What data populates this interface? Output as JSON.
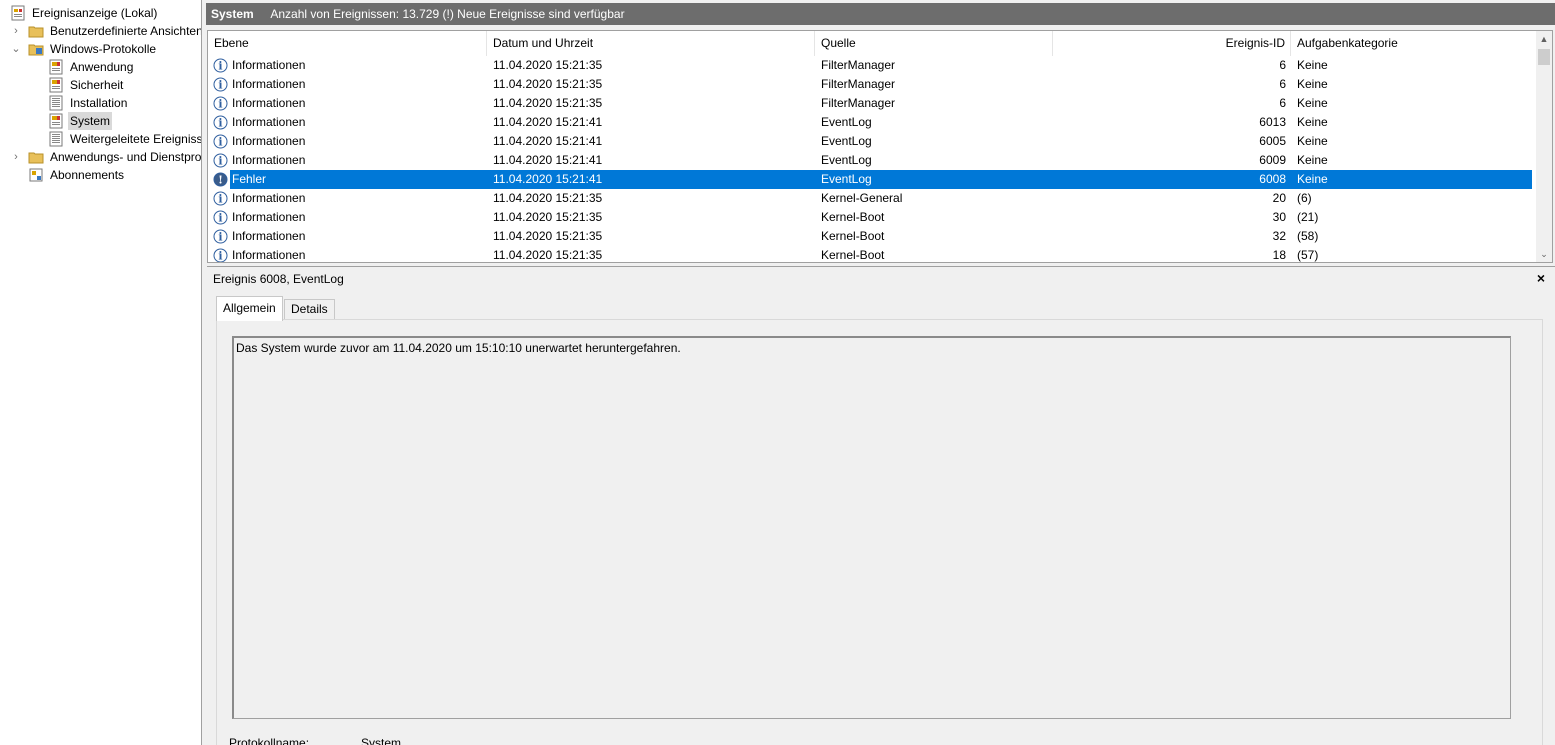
{
  "tree": {
    "root": "Ereignisanzeige (Lokal)",
    "custom_views": "Benutzerdefinierte Ansichten",
    "windows_logs": "Windows-Protokolle",
    "logs": [
      "Anwendung",
      "Sicherheit",
      "Installation",
      "System",
      "Weitergeleitete Ereignisse"
    ],
    "app_services": "Anwendungs- und Dienstprotokolle",
    "subscriptions": "Abonnements"
  },
  "header": {
    "title": "System",
    "info": "Anzahl von Ereignissen: 13.729 (!) Neue Ereignisse sind verfügbar"
  },
  "columns": {
    "level": "Ebene",
    "datetime": "Datum und Uhrzeit",
    "source": "Quelle",
    "event_id": "Ereignis-ID",
    "category": "Aufgabenkategorie"
  },
  "events": [
    {
      "level": "Informationen",
      "datetime": "11.04.2020 15:21:35",
      "source": "FilterManager",
      "id": "6",
      "category": "Keine"
    },
    {
      "level": "Informationen",
      "datetime": "11.04.2020 15:21:35",
      "source": "FilterManager",
      "id": "6",
      "category": "Keine"
    },
    {
      "level": "Informationen",
      "datetime": "11.04.2020 15:21:35",
      "source": "FilterManager",
      "id": "6",
      "category": "Keine"
    },
    {
      "level": "Informationen",
      "datetime": "11.04.2020 15:21:41",
      "source": "EventLog",
      "id": "6013",
      "category": "Keine"
    },
    {
      "level": "Informationen",
      "datetime": "11.04.2020 15:21:41",
      "source": "EventLog",
      "id": "6005",
      "category": "Keine"
    },
    {
      "level": "Informationen",
      "datetime": "11.04.2020 15:21:41",
      "source": "EventLog",
      "id": "6009",
      "category": "Keine"
    },
    {
      "level": "Fehler",
      "datetime": "11.04.2020 15:21:41",
      "source": "EventLog",
      "id": "6008",
      "category": "Keine"
    },
    {
      "level": "Informationen",
      "datetime": "11.04.2020 15:21:35",
      "source": "Kernel-General",
      "id": "20",
      "category": "(6)"
    },
    {
      "level": "Informationen",
      "datetime": "11.04.2020 15:21:35",
      "source": "Kernel-Boot",
      "id": "30",
      "category": "(21)"
    },
    {
      "level": "Informationen",
      "datetime": "11.04.2020 15:21:35",
      "source": "Kernel-Boot",
      "id": "32",
      "category": "(58)"
    },
    {
      "level": "Informationen",
      "datetime": "11.04.2020 15:21:35",
      "source": "Kernel-Boot",
      "id": "18",
      "category": "(57)"
    }
  ],
  "details": {
    "title": "Ereignis 6008, EventLog",
    "close": "×",
    "tabs": [
      "Allgemein",
      "Details"
    ],
    "message": "Das System wurde zuvor am 11.04.2020 um 15:10:10 unerwartet heruntergefahren.",
    "protocol_label": "Protokollname:",
    "protocol_value": "System"
  },
  "colors": {
    "header_bg": "#6d6d6d",
    "selection": "#0078d7",
    "info_icon": "#2f5f9f"
  }
}
